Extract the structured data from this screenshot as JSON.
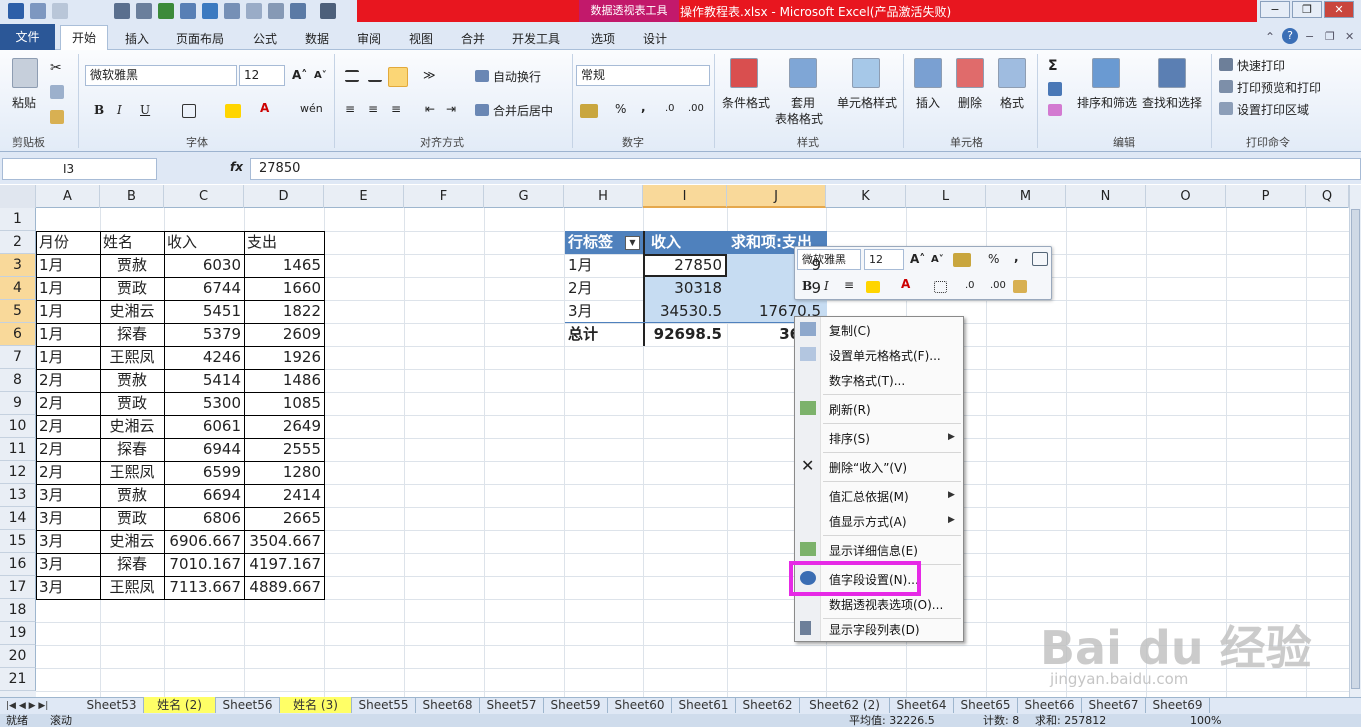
{
  "window": {
    "context_tab": "数据透视表工具",
    "title": "操作教程表.xlsx - Microsoft Excel(产品激活失败)"
  },
  "tabs": [
    "文件",
    "开始",
    "插入",
    "页面布局",
    "公式",
    "数据",
    "审阅",
    "视图",
    "合并",
    "开发工具",
    "选项",
    "设计"
  ],
  "ribbon": {
    "clipboard": {
      "label": "剪贴板",
      "paste": "粘贴"
    },
    "font": {
      "label": "字体",
      "name": "微软雅黑",
      "size": "12"
    },
    "align": {
      "label": "对齐方式",
      "wrap": "自动换行",
      "merge": "合并后居中"
    },
    "number": {
      "label": "数字",
      "format": "常规"
    },
    "styles": {
      "label": "样式",
      "cond": "条件格式",
      "table1": "套用",
      "table2": "表格格式",
      "cell": "单元格样式"
    },
    "cells": {
      "label": "单元格",
      "insert": "插入",
      "delete": "删除",
      "format": "格式"
    },
    "edit": {
      "label": "编辑",
      "sort": "排序和筛选",
      "find": "查找和选择"
    },
    "print": {
      "label": "打印命令",
      "quick": "快速打印",
      "preview": "打印预览和打印",
      "area": "设置打印区域"
    }
  },
  "formula": {
    "namebox": "I3",
    "fx": "fx",
    "value": "27850"
  },
  "columns": [
    "A",
    "B",
    "C",
    "D",
    "E",
    "F",
    "G",
    "H",
    "I",
    "J",
    "K",
    "L",
    "M",
    "N",
    "O",
    "P",
    "Q"
  ],
  "rows": [
    "1",
    "2",
    "3",
    "4",
    "5",
    "6",
    "7",
    "8",
    "9",
    "10",
    "11",
    "12",
    "13",
    "14",
    "15",
    "16",
    "17",
    "18",
    "19",
    "20",
    "21"
  ],
  "table": {
    "headers": [
      "月份",
      "姓名",
      "收入",
      "支出"
    ],
    "data": [
      [
        "1月",
        "贾赦",
        "6030",
        "1465"
      ],
      [
        "1月",
        "贾政",
        "6744",
        "1660"
      ],
      [
        "1月",
        "史湘云",
        "5451",
        "1822"
      ],
      [
        "1月",
        "探春",
        "5379",
        "2609"
      ],
      [
        "1月",
        "王熙凤",
        "4246",
        "1926"
      ],
      [
        "2月",
        "贾赦",
        "5414",
        "1486"
      ],
      [
        "2月",
        "贾政",
        "5300",
        "1085"
      ],
      [
        "2月",
        "史湘云",
        "6061",
        "2649"
      ],
      [
        "2月",
        "探春",
        "6944",
        "2555"
      ],
      [
        "2月",
        "王熙凤",
        "6599",
        "1280"
      ],
      [
        "3月",
        "贾赦",
        "6694",
        "2414"
      ],
      [
        "3月",
        "贾政",
        "6806",
        "2665"
      ],
      [
        "3月",
        "史湘云",
        "6906.667",
        "3504.667"
      ],
      [
        "3月",
        "探春",
        "7010.167",
        "4197.167"
      ],
      [
        "3月",
        "王熙凤",
        "7113.667",
        "4889.667"
      ]
    ]
  },
  "pivot": {
    "headers": [
      "行标签",
      "收入",
      "求和项:支出"
    ],
    "rows": [
      [
        "1月",
        "27850",
        "9"
      ],
      [
        "2月",
        "30318",
        "9"
      ],
      [
        "3月",
        "34530.5",
        "17670.5"
      ]
    ],
    "total": [
      "总计",
      "92698.5",
      "3620"
    ]
  },
  "mini_toolbar": {
    "font": "微软雅黑",
    "size": "12"
  },
  "context_menu": [
    {
      "label": "复制(C)",
      "icon": "copy-icon"
    },
    {
      "label": "设置单元格格式(F)...",
      "icon": "format-cells-icon"
    },
    {
      "label": "数字格式(T)...",
      "icon": ""
    },
    {
      "label": "刷新(R)",
      "icon": "refresh-icon"
    },
    {
      "label": "排序(S)",
      "icon": ""
    },
    {
      "label": "删除“收入”(V)",
      "icon": "delete-icon"
    },
    {
      "label": "值汇总依据(M)",
      "icon": ""
    },
    {
      "label": "值显示方式(A)",
      "icon": ""
    },
    {
      "label": "显示详细信息(E)",
      "icon": "show-detail-icon"
    },
    {
      "label": "值字段设置(N)...",
      "icon": "field-settings-icon"
    },
    {
      "label": "数据透视表选项(O)...",
      "icon": ""
    },
    {
      "label": "显示字段列表(D)",
      "icon": "field-list-icon"
    }
  ],
  "sheets": [
    "Sheet53",
    "姓名 (2)",
    "Sheet56",
    "姓名 (3)",
    "Sheet55",
    "Sheet68",
    "Sheet57",
    "Sheet59",
    "Sheet60",
    "Sheet61",
    "Sheet62",
    "Sheet62 (2)",
    "Sheet64",
    "Sheet65",
    "Sheet66",
    "Sheet67",
    "Sheet69"
  ],
  "status": {
    "ready": "就绪",
    "scroll": "滚动",
    "average": "平均值: 32226.5",
    "count": "计数: 8",
    "sum": "求和: 257812",
    "zoom": "100%"
  },
  "watermark": {
    "main": "Bai du 经验",
    "sub": "jingyan.baidu.com"
  },
  "colors": {
    "pivot_header": "#4f81bd",
    "highlight_box": "#e629e6",
    "selection": "#c6dcf2",
    "title_red": "#e8161f",
    "context_tab": "#c2196b"
  }
}
